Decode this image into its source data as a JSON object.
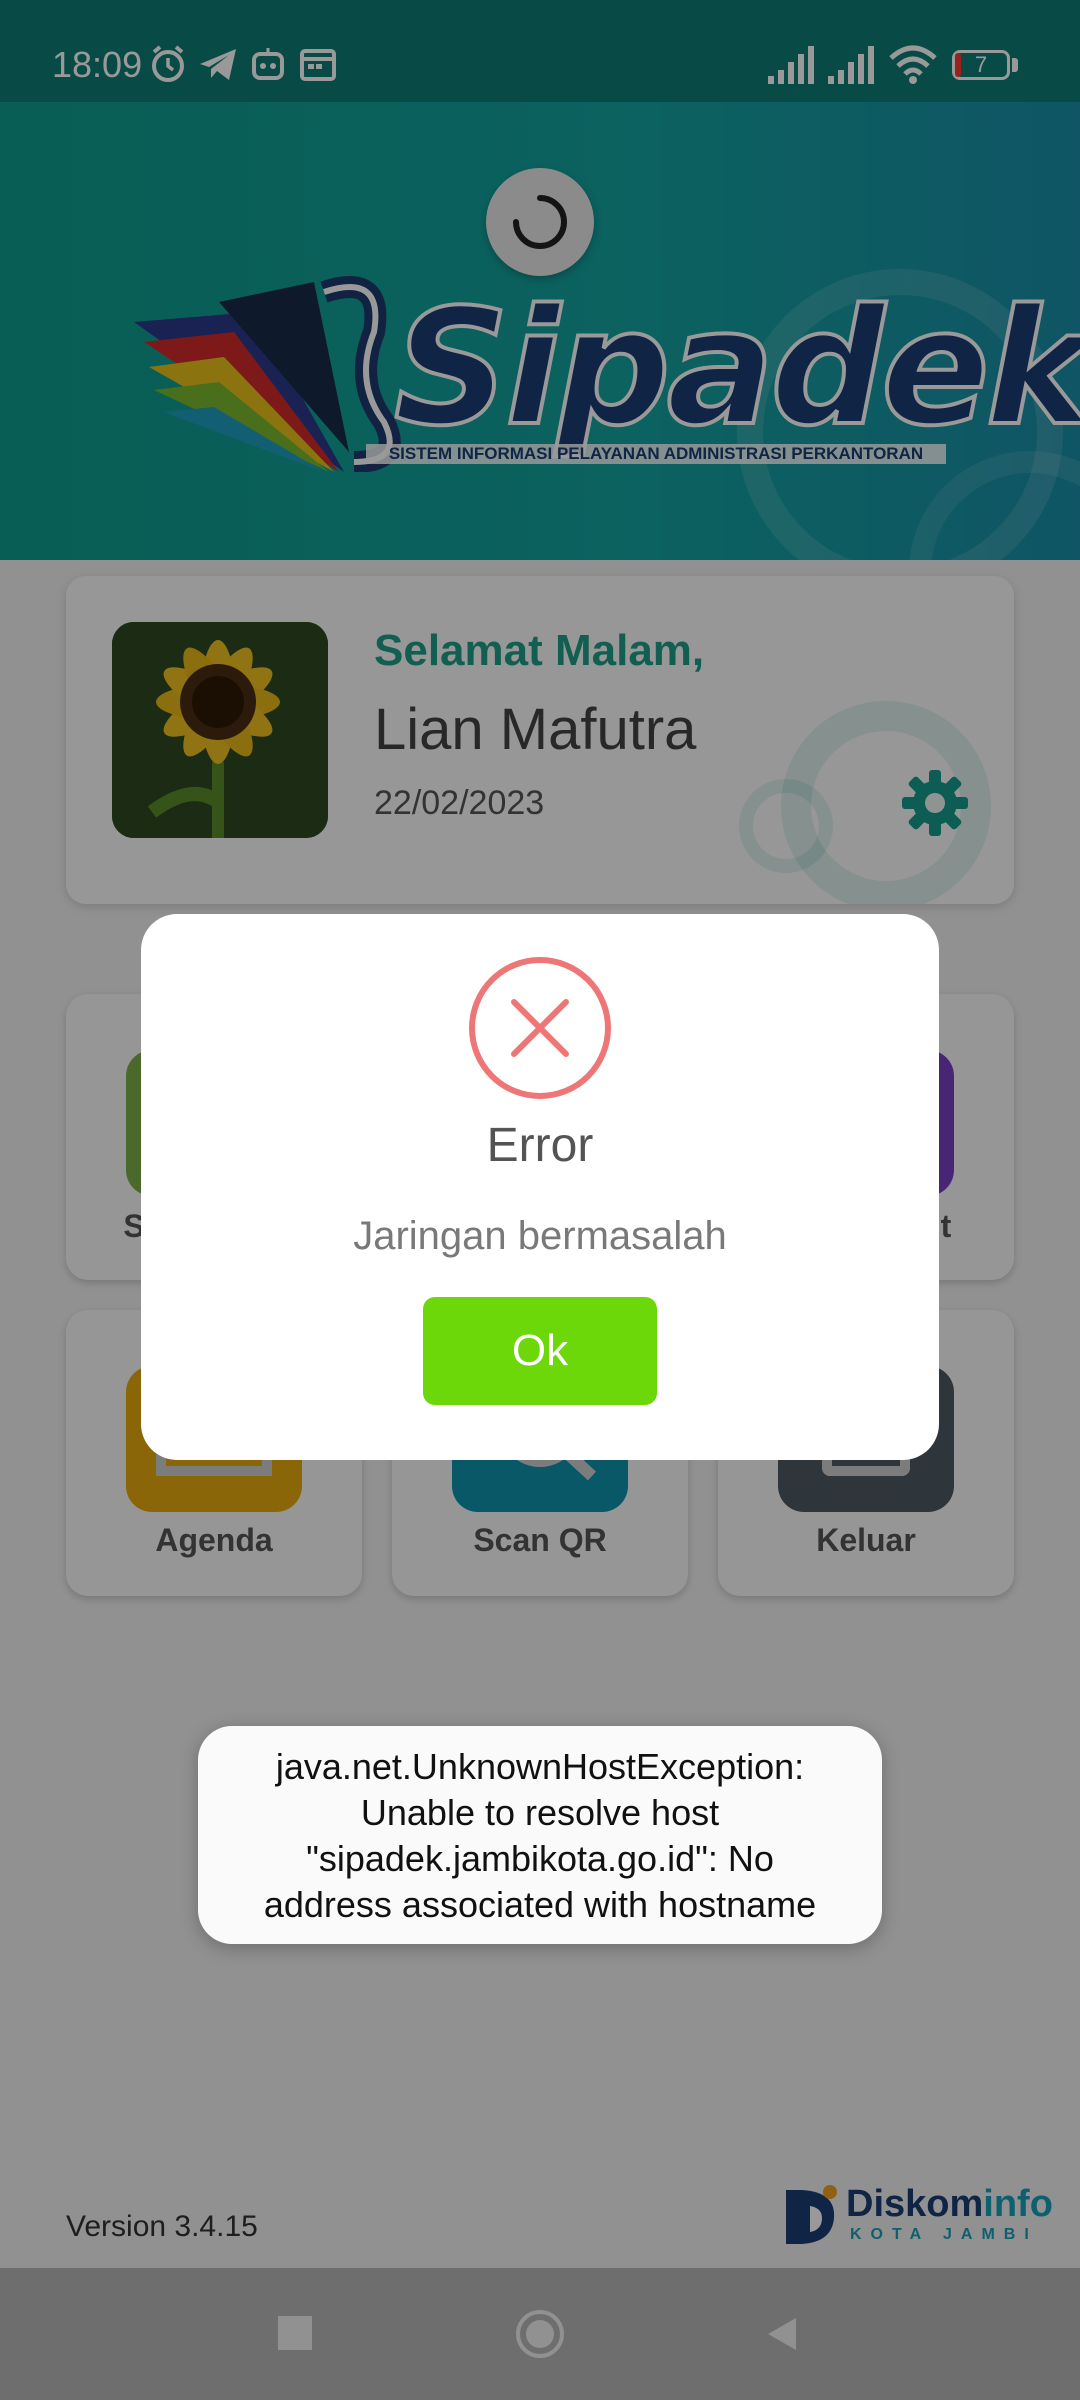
{
  "status_bar": {
    "time": "18:09",
    "battery_level": "7",
    "icons": [
      "alarm-icon",
      "telegram-icon",
      "robot-icon",
      "calendar-icon",
      "signal-icon",
      "signal-icon",
      "wifi-icon",
      "battery-icon"
    ]
  },
  "app": {
    "logo_text": "Sipadek",
    "logo_tagline": "SISTEM INFORMASI PELAYANAN ADMINISTRASI PERKANTORAN"
  },
  "profile": {
    "greeting": "Selamat Malam,",
    "name": "Lian Mafutra",
    "date": "22/02/2023"
  },
  "menu": {
    "row1": [
      {
        "label": "S",
        "color": "#7fb04a",
        "icon": "document-icon"
      },
      {
        "label": "",
        "color": "#1aa0b8",
        "icon": "folder-icon"
      },
      {
        "label": "t",
        "color": "#7b3fc4",
        "icon": "report-icon"
      }
    ],
    "row2": [
      {
        "label": "Agenda",
        "color": "#e8ab0e",
        "icon": "agenda-icon"
      },
      {
        "label": "Scan QR",
        "color": "#0e93ad",
        "icon": "scan-qr-icon"
      },
      {
        "label": "Keluar",
        "color": "#4e5a63",
        "icon": "logout-icon"
      }
    ]
  },
  "dialog": {
    "title": "Error",
    "message": "Jaringan bermasalah",
    "ok_label": "Ok"
  },
  "toast": {
    "line1": "java.net.UnknownHostException:",
    "line2": "Unable to resolve host",
    "line3": "\"sipadek.jambikota.go.id\": No",
    "line4": "address associated with hostname"
  },
  "footer": {
    "version": "Version 3.4.15",
    "brand_primary": "Diskom",
    "brand_secondary": "info",
    "brand_sub": "KOTA JAMBI"
  },
  "colors": {
    "teal": "#14a08f",
    "ok_green": "#6cd80a",
    "error_red": "#ef7676"
  }
}
